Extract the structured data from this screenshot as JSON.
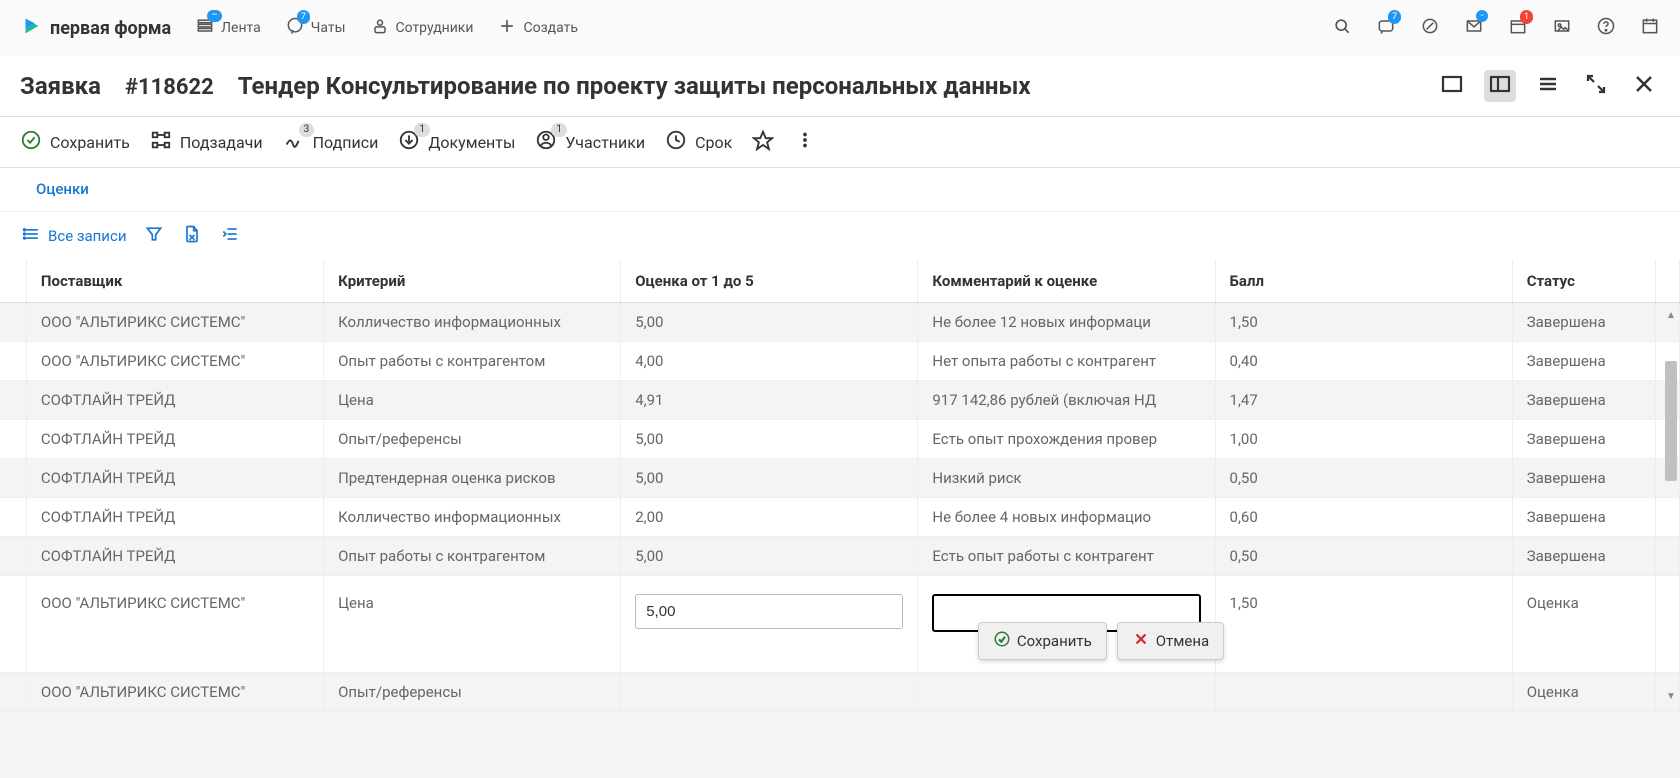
{
  "brand": "первая форма",
  "topnav": {
    "feed": "Лента",
    "chats": "Чаты",
    "chats_badge": "7",
    "staff": "Сотрудники",
    "create": "Создать"
  },
  "rightnav": {
    "chat_badge": "7",
    "inbox_badge": "-",
    "cal_badge": "1"
  },
  "header": {
    "type": "Заявка",
    "id": "#118622",
    "title": "Тендер Консультирование по проекту защиты персональных данных"
  },
  "toolbar": {
    "save": "Сохранить",
    "subtasks": "Подзадачи",
    "signatures": "Подписи",
    "signatures_badge": "3",
    "documents": "Документы",
    "documents_badge": "1",
    "participants": "Участники",
    "participants_badge": "1",
    "deadline": "Срок"
  },
  "tab": "Оценки",
  "filters": {
    "all": "Все записи"
  },
  "columns": {
    "supplier": "Поставщик",
    "criteria": "Критерий",
    "score": "Оценка от 1 до 5",
    "comment": "Комментарий к оценке",
    "ball": "Балл",
    "status": "Статус"
  },
  "rows": [
    {
      "supplier": "ООО \"АЛЬТИРИКС СИСТЕМС\"",
      "criteria": "Колличество информационных",
      "score": "5,00",
      "comment": "Не более 12 новых информаци",
      "ball": "1,50",
      "status": "Завершена"
    },
    {
      "supplier": "ООО \"АЛЬТИРИКС СИСТЕМС\"",
      "criteria": "Опыт работы с контрагентом",
      "score": "4,00",
      "comment": "Нет опыта работы с контрагент",
      "ball": "0,40",
      "status": "Завершена"
    },
    {
      "supplier": "СОФТЛАЙН ТРЕЙД",
      "criteria": "Цена",
      "score": "4,91",
      "comment": "917 142,86 рублей (включая НД",
      "ball": "1,47",
      "status": "Завершена"
    },
    {
      "supplier": "СОФТЛАЙН ТРЕЙД",
      "criteria": "Опыт/референсы",
      "score": "5,00",
      "comment": "Есть опыт прохождения провер",
      "ball": "1,00",
      "status": "Завершена"
    },
    {
      "supplier": "СОФТЛАЙН ТРЕЙД",
      "criteria": "Предтендерная оценка рисков",
      "score": "5,00",
      "comment": "Низкий риск",
      "ball": "0,50",
      "status": "Завершена"
    },
    {
      "supplier": "СОФТЛАЙН ТРЕЙД",
      "criteria": "Колличество информационных",
      "score": "2,00",
      "comment": "Не более 4 новых информацио",
      "ball": "0,60",
      "status": "Завершена"
    },
    {
      "supplier": "СОФТЛАЙН ТРЕЙД",
      "criteria": "Опыт работы с контрагентом",
      "score": "5,00",
      "comment": "Есть опыт работы с контрагент",
      "ball": "0,50",
      "status": "Завершена"
    },
    {
      "supplier": "ООО \"АЛЬТИРИКС СИСТЕМС\"",
      "criteria": "Цена",
      "score": "5,00",
      "comment": "",
      "ball": "1,50",
      "status": "Оценка",
      "editing": true
    },
    {
      "supplier": "ООО \"АЛЬТИРИКС СИСТЕМС\"",
      "criteria": "Опыт/референсы",
      "score": "",
      "comment": "",
      "ball": "",
      "status": "Оценка"
    }
  ],
  "popup": {
    "save": "Сохранить",
    "cancel": "Отмена"
  }
}
